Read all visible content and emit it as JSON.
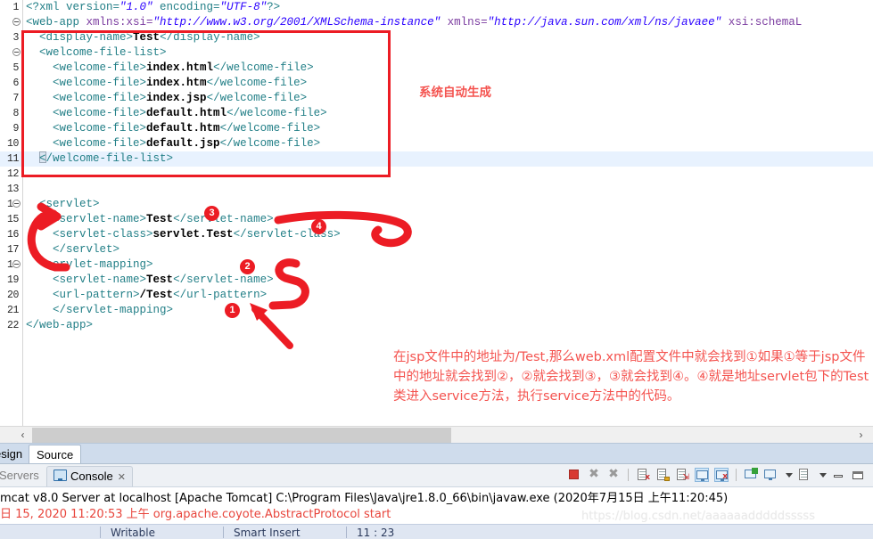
{
  "editor": {
    "lines": [
      {
        "n": "1",
        "fold": false,
        "indent": 0,
        "segments": [
          {
            "t": "<?xml version=",
            "c": "pi"
          },
          {
            "t": "\"1.0\"",
            "c": "str"
          },
          {
            "t": " encoding=",
            "c": "pi"
          },
          {
            "t": "\"UTF-8\"",
            "c": "str"
          },
          {
            "t": "?>",
            "c": "pi"
          }
        ]
      },
      {
        "n": "2",
        "fold": true,
        "indent": 0,
        "segments": [
          {
            "t": "<web-app ",
            "c": "tag"
          },
          {
            "t": "xmlns:xsi=",
            "c": "attr"
          },
          {
            "t": "\"http://www.w3.org/2001/XMLSchema-instance\"",
            "c": "str"
          },
          {
            "t": " ",
            "c": "tag"
          },
          {
            "t": "xmlns=",
            "c": "attr"
          },
          {
            "t": "\"http://java.sun.com/xml/ns/javaee\"",
            "c": "str"
          },
          {
            "t": " ",
            "c": "tag"
          },
          {
            "t": "xsi:schemaL",
            "c": "attr"
          }
        ]
      },
      {
        "n": "3",
        "fold": false,
        "indent": 1,
        "segments": [
          {
            "t": "<display-name>",
            "c": "tag"
          },
          {
            "t": "Test",
            "c": "val"
          },
          {
            "t": "</display-name>",
            "c": "tag"
          }
        ]
      },
      {
        "n": "4",
        "fold": true,
        "indent": 1,
        "segments": [
          {
            "t": "<welcome-file-list>",
            "c": "tag"
          }
        ]
      },
      {
        "n": "5",
        "fold": false,
        "indent": 2,
        "segments": [
          {
            "t": "<welcome-file>",
            "c": "tag"
          },
          {
            "t": "index.html",
            "c": "val"
          },
          {
            "t": "</welcome-file>",
            "c": "tag"
          }
        ]
      },
      {
        "n": "6",
        "fold": false,
        "indent": 2,
        "segments": [
          {
            "t": "<welcome-file>",
            "c": "tag"
          },
          {
            "t": "index.htm",
            "c": "val"
          },
          {
            "t": "</welcome-file>",
            "c": "tag"
          }
        ]
      },
      {
        "n": "7",
        "fold": false,
        "indent": 2,
        "segments": [
          {
            "t": "<welcome-file>",
            "c": "tag"
          },
          {
            "t": "index.jsp",
            "c": "val"
          },
          {
            "t": "</welcome-file>",
            "c": "tag"
          }
        ]
      },
      {
        "n": "8",
        "fold": false,
        "indent": 2,
        "segments": [
          {
            "t": "<welcome-file>",
            "c": "tag"
          },
          {
            "t": "default.html",
            "c": "val"
          },
          {
            "t": "</welcome-file>",
            "c": "tag"
          }
        ]
      },
      {
        "n": "9",
        "fold": false,
        "indent": 2,
        "segments": [
          {
            "t": "<welcome-file>",
            "c": "tag"
          },
          {
            "t": "default.htm",
            "c": "val"
          },
          {
            "t": "</welcome-file>",
            "c": "tag"
          }
        ]
      },
      {
        "n": "10",
        "fold": false,
        "indent": 2,
        "segments": [
          {
            "t": "<welcome-file>",
            "c": "tag"
          },
          {
            "t": "default.jsp",
            "c": "val"
          },
          {
            "t": "</welcome-file>",
            "c": "tag"
          }
        ]
      },
      {
        "n": "11",
        "fold": false,
        "indent": 1,
        "caret": true,
        "hl": true,
        "segments": [
          {
            "t": "</welcome-file-list>",
            "c": "tag"
          }
        ]
      },
      {
        "n": "12",
        "fold": false,
        "indent": 0,
        "segments": []
      },
      {
        "n": "13",
        "fold": false,
        "indent": 0,
        "segments": []
      },
      {
        "n": "14",
        "fold": true,
        "indent": 1,
        "segments": [
          {
            "t": "<servlet>",
            "c": "tag"
          }
        ]
      },
      {
        "n": "15",
        "fold": false,
        "indent": 2,
        "segments": [
          {
            "t": "<servlet-name>",
            "c": "tag"
          },
          {
            "t": "Test",
            "c": "val"
          },
          {
            "t": "</servlet-name>",
            "c": "tag"
          }
        ]
      },
      {
        "n": "16",
        "fold": false,
        "indent": 2,
        "segments": [
          {
            "t": "<servlet-class>",
            "c": "tag"
          },
          {
            "t": "servlet.Test",
            "c": "val"
          },
          {
            "t": "</servlet-class>",
            "c": "tag"
          }
        ]
      },
      {
        "n": "17",
        "fold": false,
        "indent": 2,
        "segments": [
          {
            "t": "</servlet>",
            "c": "tag"
          }
        ]
      },
      {
        "n": "18",
        "fold": true,
        "indent": 1,
        "segments": [
          {
            "t": "<servlet-mapping>",
            "c": "tag"
          }
        ]
      },
      {
        "n": "19",
        "fold": false,
        "indent": 2,
        "segments": [
          {
            "t": "<servlet-name>",
            "c": "tag"
          },
          {
            "t": "Test",
            "c": "val"
          },
          {
            "t": "</servlet-name>",
            "c": "tag"
          }
        ]
      },
      {
        "n": "20",
        "fold": false,
        "indent": 2,
        "segments": [
          {
            "t": "<url-pattern>",
            "c": "tag"
          },
          {
            "t": "/Test",
            "c": "val"
          },
          {
            "t": "</url-pattern>",
            "c": "tag"
          }
        ]
      },
      {
        "n": "21",
        "fold": false,
        "indent": 2,
        "segments": [
          {
            "t": "</servlet-mapping>",
            "c": "tag"
          }
        ]
      },
      {
        "n": "22",
        "fold": false,
        "indent": 0,
        "segments": [
          {
            "t": "</web-app>",
            "c": "tag"
          }
        ]
      }
    ]
  },
  "annotations": {
    "accent_color": "#ec1c24",
    "text_color": "#f4534f",
    "auto_generated_note": "系统自动生成",
    "explanation": "在jsp文件中的地址为/Test,那么web.xml配置文件中就会找到①如果①等于jsp文件中的地址就会找到②，②就会找到③，③就会找到④。④就是地址servlet包下的Test类进入service方法，执行service方法中的代码。",
    "markers": [
      {
        "id": "1",
        "label": "1"
      },
      {
        "id": "2",
        "label": "2"
      },
      {
        "id": "3",
        "label": "3"
      },
      {
        "id": "4",
        "label": "4"
      }
    ]
  },
  "scrollbar": {
    "left_arrow": "‹",
    "right_arrow": "›"
  },
  "editor_tabs": {
    "design_label": "esign",
    "source_label": "Source"
  },
  "console_view": {
    "servers_tab_label": "Servers",
    "console_tab_label": "Console",
    "close_glyph": "✕",
    "header": "mcat v8.0 Server at localhost [Apache Tomcat] C:\\Program Files\\Java\\jre1.8.0_66\\bin\\javaw.exe (2020年7月15日 上午11:20:45)",
    "log_line": "日 15, 2020 11:20:53 上午 org.apache.coyote.AbstractProtocol start",
    "toolbar": [
      {
        "name": "terminate-button",
        "kind": "stop"
      },
      {
        "name": "remove-launch-button",
        "kind": "x"
      },
      {
        "name": "remove-all-launches-button",
        "kind": "xx"
      },
      {
        "name": "separator-1",
        "kind": "sep"
      },
      {
        "name": "clear-console-button",
        "kind": "doc-x"
      },
      {
        "name": "scroll-lock-button",
        "kind": "doc-lock"
      },
      {
        "name": "word-wrap-button",
        "kind": "doc-wrap"
      },
      {
        "name": "show-console-on-output-button",
        "kind": "console-out",
        "active": true
      },
      {
        "name": "show-console-on-error-button",
        "kind": "console-err",
        "active": true
      },
      {
        "name": "separator-2",
        "kind": "sep"
      },
      {
        "name": "pin-console-button",
        "kind": "pin"
      },
      {
        "name": "display-selected-console-button",
        "kind": "monitor-dd"
      },
      {
        "name": "open-console-button",
        "kind": "new-console-dd"
      },
      {
        "name": "minimize-button",
        "kind": "minimize"
      },
      {
        "name": "maximize-button",
        "kind": "maximize"
      }
    ]
  },
  "statusbar": {
    "cells": [
      "",
      "Writable",
      "Smart Insert",
      "11 : 23"
    ]
  },
  "watermark": "https://blog.csdn.net/aaaaaadddddsssss"
}
